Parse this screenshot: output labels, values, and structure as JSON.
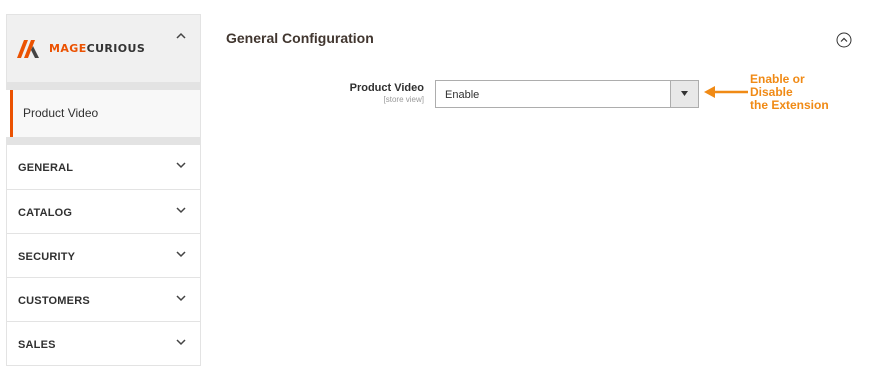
{
  "brand": {
    "name_prefix": "MAGE",
    "name_suffix": "CURIOUS",
    "accent_color": "#eb5202"
  },
  "sidebar": {
    "active_item": "Product Video",
    "sections": [
      {
        "label": "GENERAL"
      },
      {
        "label": "CATALOG"
      },
      {
        "label": "SECURITY"
      },
      {
        "label": "CUSTOMERS"
      },
      {
        "label": "SALES"
      }
    ]
  },
  "main": {
    "title": "General Configuration",
    "field": {
      "label": "Product Video",
      "scope": "[store view]",
      "value": "Enable"
    },
    "annotation": {
      "lines": [
        "Enable or",
        "Disable",
        "the Extension"
      ],
      "color": "#f08a15"
    }
  }
}
